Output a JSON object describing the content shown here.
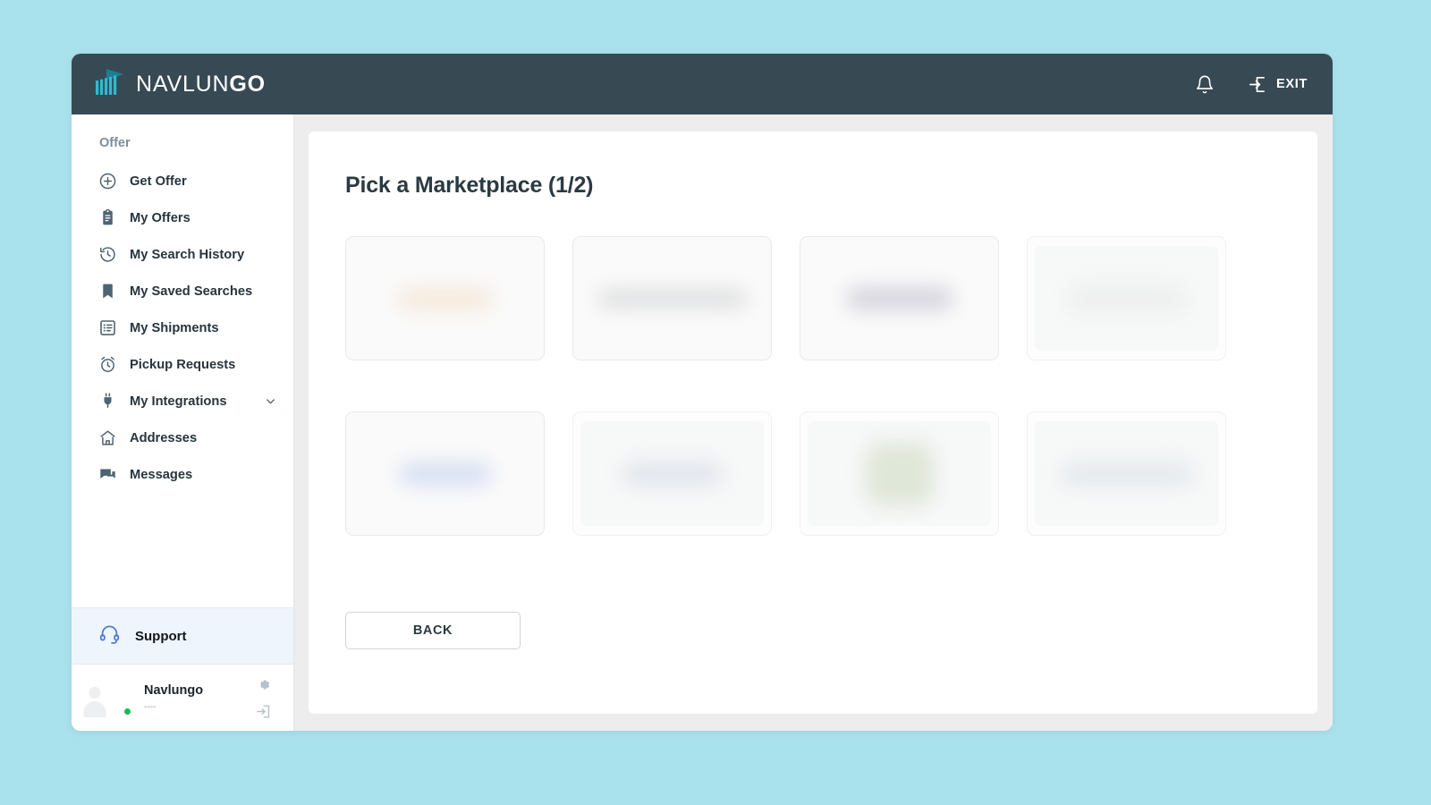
{
  "header": {
    "brand_prefix": "NAVLUN",
    "brand_suffix": "GO",
    "logo_icon": "navlungo-bars-logo",
    "notification_icon": "bell-icon",
    "exit_icon": "exit-arrow-icon",
    "exit_label": "EXIT",
    "bar_color": "#374a53",
    "logo_color": "#24b4cf"
  },
  "sidebar": {
    "section_label": "Offer",
    "items": [
      {
        "label": "Get Offer",
        "icon": "plus-circle-icon",
        "has_chevron": false
      },
      {
        "label": "My Offers",
        "icon": "clipboard-icon",
        "has_chevron": false
      },
      {
        "label": "My Search History",
        "icon": "history-icon",
        "has_chevron": false
      },
      {
        "label": "My Saved Searches",
        "icon": "bookmark-icon",
        "has_chevron": false
      },
      {
        "label": "My Shipments",
        "icon": "list-box-icon",
        "has_chevron": false
      },
      {
        "label": "Pickup Requests",
        "icon": "alarm-clock-icon",
        "has_chevron": false
      },
      {
        "label": "My Integrations",
        "icon": "plug-icon",
        "has_chevron": true
      },
      {
        "label": "Addresses",
        "icon": "home-icon",
        "has_chevron": false
      },
      {
        "label": "Messages",
        "icon": "chat-bubbles-icon",
        "has_chevron": false
      }
    ],
    "support": {
      "label": "Support",
      "icon": "headset-icon",
      "highlight_color": "#eff5fd",
      "icon_color": "#4f7bd4"
    },
    "profile": {
      "name": "Navlungo",
      "subtitle": "----",
      "avatar_icon": "user-avatar",
      "status": "online",
      "status_color": "#1db954",
      "settings_icon": "gear-icon",
      "logout_icon": "logout-icon"
    }
  },
  "main": {
    "title": "Pick a Marketplace (1/2)",
    "back_label": "BACK",
    "marketplaces": [
      {
        "name": "marketplace-card-1",
        "blob_color": "#f3dcc6",
        "blob_w": 108,
        "blob_h": 26,
        "plate": false,
        "white": false
      },
      {
        "name": "marketplace-card-2",
        "blob_color": "#c9cbcd",
        "blob_w": 168,
        "blob_h": 22,
        "plate": false,
        "white": false
      },
      {
        "name": "marketplace-card-3",
        "blob_color": "#b9b6c8",
        "blob_w": 120,
        "blob_h": 26,
        "plate": false,
        "white": false
      },
      {
        "name": "marketplace-card-4",
        "blob_color": "#e6e7e8",
        "blob_w": 132,
        "blob_h": 30,
        "plate": true,
        "white": true
      },
      {
        "name": "marketplace-card-5",
        "blob_color": "#b9c9ef",
        "blob_w": 104,
        "blob_h": 26,
        "plate": false,
        "white": false
      },
      {
        "name": "marketplace-card-6",
        "blob_color": "#ced5e4",
        "blob_w": 112,
        "blob_h": 26,
        "plate": true,
        "white": true
      },
      {
        "name": "marketplace-card-7",
        "blob_color": "#ccd9bd",
        "blob_w": 76,
        "blob_h": 70,
        "plate": true,
        "white": true
      },
      {
        "name": "marketplace-card-8",
        "blob_color": "#d3dde4",
        "blob_w": 150,
        "blob_h": 26,
        "plate": true,
        "white": true
      }
    ]
  }
}
